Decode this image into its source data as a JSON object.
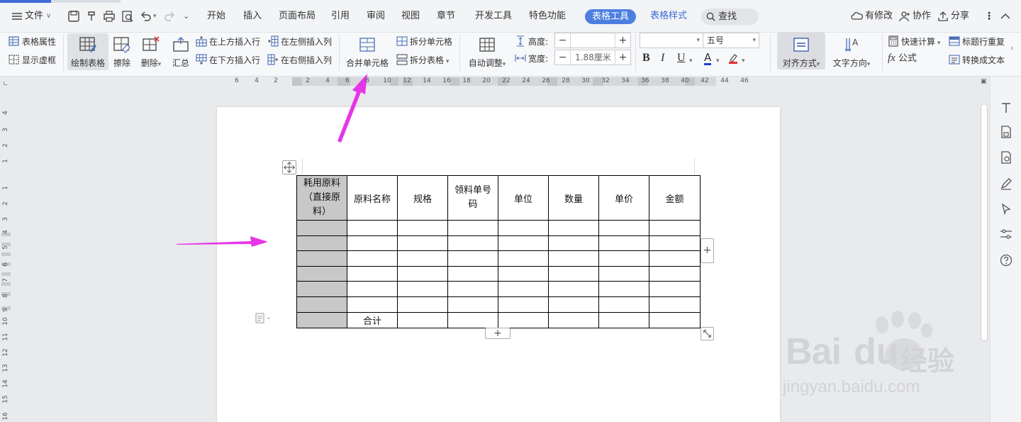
{
  "menubar": {
    "file_label": "文件",
    "tabs": [
      "开始",
      "插入",
      "页面布局",
      "引用",
      "审阅",
      "视图",
      "章节",
      "开发工具",
      "特色功能"
    ],
    "active_tab": "表格工具",
    "extra_tab": "表格样式",
    "search_label": "查找",
    "right_items": [
      "有修改",
      "协作",
      "分享"
    ]
  },
  "ribbon": {
    "table_props": "表格属性",
    "show_gridlines": "显示虚框",
    "draw_table": "绘制表格",
    "erase": "擦除",
    "delete": "删除",
    "summary": "汇总",
    "insert_row_above": "在上方插入行",
    "insert_row_below": "在下方插入行",
    "insert_col_left": "在左侧插入列",
    "insert_col_right": "在右侧插入列",
    "merge_cells": "合并单元格",
    "split_cells": "拆分单元格",
    "split_table": "拆分表格",
    "auto_fit": "自动调整",
    "height_label": "高度:",
    "height_value": "",
    "width_label": "宽度:",
    "width_value": "1.88厘米",
    "font_name": "",
    "font_size": "五号",
    "bold": "B",
    "italic": "I",
    "underline": "U",
    "font_color": "A",
    "align_label": "对齐方式",
    "text_direction": "文字方向",
    "quick_calc": "快速计算",
    "formula": "公式",
    "repeat_header": "标题行重复",
    "to_text": "转换成文本"
  },
  "ruler": {
    "h_marks": [
      "6",
      "4",
      "2",
      "2",
      "4",
      "6",
      "8",
      "10",
      "12",
      "14",
      "16",
      "18",
      "20",
      "22",
      "24",
      "26",
      "28",
      "30",
      "32",
      "34",
      "36",
      "38",
      "40",
      "42",
      "44",
      "46"
    ],
    "v_marks": [
      "4",
      "3",
      "2",
      "1",
      "1",
      "2",
      "3",
      "4",
      "5",
      "6",
      "7",
      "8",
      "9",
      "10",
      "11",
      "12",
      "13",
      "14",
      "15",
      "16"
    ]
  },
  "table": {
    "header": [
      "耗用原料（直接原料）",
      "原料名称",
      "规格",
      "领料单号码",
      "单位",
      "数量",
      "单价",
      "金额"
    ],
    "blank_rows": 6,
    "footer": [
      "",
      "合计",
      "",
      "",
      "",
      "",
      "",
      ""
    ]
  },
  "watermark": {
    "brand": "Bai",
    "brand2": "du",
    "product": "经验",
    "url": "jingyan.baidu.com"
  },
  "colors": {
    "accent": "#4d7fe0",
    "annotation_arrow": "#e535e8",
    "shaded_cell": "#c8c8c8"
  }
}
